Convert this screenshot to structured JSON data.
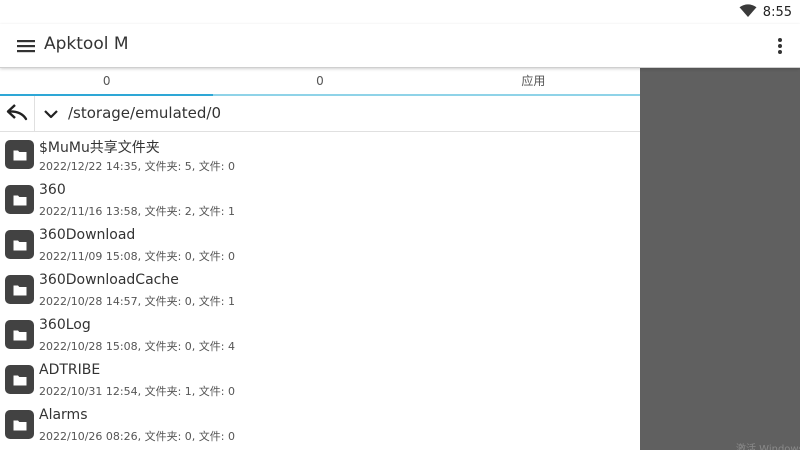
{
  "status_bar": {
    "time": "8:55",
    "wifi_icon": "wifi-icon"
  },
  "app_bar": {
    "title": "Apktool M",
    "menu_icon": "hamburger-menu-icon",
    "more_icon": "more-vert-icon"
  },
  "tabs": [
    {
      "label": "0",
      "active": true
    },
    {
      "label": "0",
      "active": false
    },
    {
      "label": "应用",
      "active": false
    }
  ],
  "path_bar": {
    "back_icon": "reply-arrow-icon",
    "expand_icon": "chevron-down-icon",
    "path": "/storage/emulated/0"
  },
  "files": [
    {
      "name": "$MuMu共享文件夹",
      "meta": "2022/12/22 14:35, 文件夹: 5, 文件: 0"
    },
    {
      "name": "360",
      "meta": "2022/11/16 13:58, 文件夹: 2, 文件: 1"
    },
    {
      "name": "360Download",
      "meta": "2022/11/09 15:08, 文件夹: 0, 文件: 0"
    },
    {
      "name": "360DownloadCache",
      "meta": "2022/10/28 14:57, 文件夹: 0, 文件: 1"
    },
    {
      "name": "360Log",
      "meta": "2022/10/28 15:08, 文件夹: 0, 文件: 4"
    },
    {
      "name": "ADTRIBE",
      "meta": "2022/10/31 12:54, 文件夹: 1, 文件: 0"
    },
    {
      "name": "Alarms",
      "meta": "2022/10/26 08:26, 文件夹: 0, 文件: 0"
    }
  ],
  "watermark": "激活 Windows",
  "colors": {
    "accent": "#2ea7d6",
    "tab_line": "#8fd3e8",
    "side_panel": "#606060",
    "folder_tile": "#424242"
  }
}
